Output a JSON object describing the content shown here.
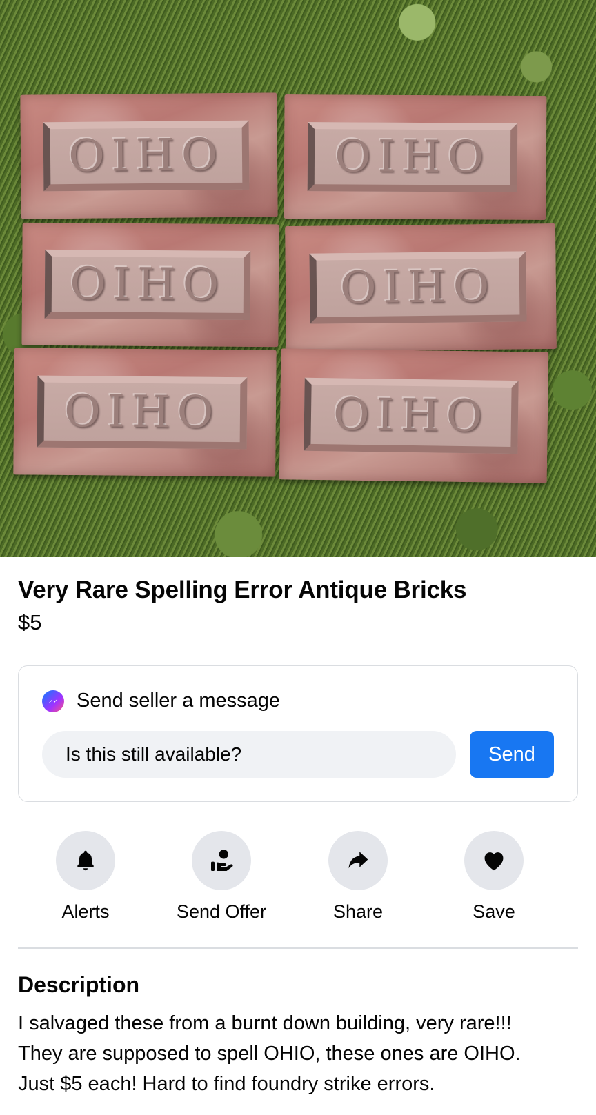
{
  "photo": {
    "bricks": [
      {
        "stamp": "OIHO"
      },
      {
        "stamp": "OIHO"
      },
      {
        "stamp": "OIHO"
      },
      {
        "stamp": "OIHO"
      },
      {
        "stamp": "OIHO"
      },
      {
        "stamp": "OIHO"
      }
    ]
  },
  "listing": {
    "title": "Very Rare Spelling Error Antique Bricks",
    "price": "$5"
  },
  "message": {
    "heading": "Send seller a message",
    "input_value": "Is this still available?",
    "send_label": "Send"
  },
  "actions": [
    {
      "label": "Alerts",
      "icon": "bell-icon"
    },
    {
      "label": "Send Offer",
      "icon": "offer-icon"
    },
    {
      "label": "Share",
      "icon": "share-arrow-icon"
    },
    {
      "label": "Save",
      "icon": "heart-icon"
    }
  ],
  "description": {
    "heading": "Description",
    "lines": [
      "I salvaged these from a burnt down building, very rare!!!",
      "They are supposed to spell OHIO, these ones are OIHO.",
      "Just $5 each!  Hard to find foundry strike errors."
    ]
  },
  "colors": {
    "accent": "#1877f2",
    "button_bg": "#e4e6eb",
    "input_bg": "#f0f2f5"
  }
}
